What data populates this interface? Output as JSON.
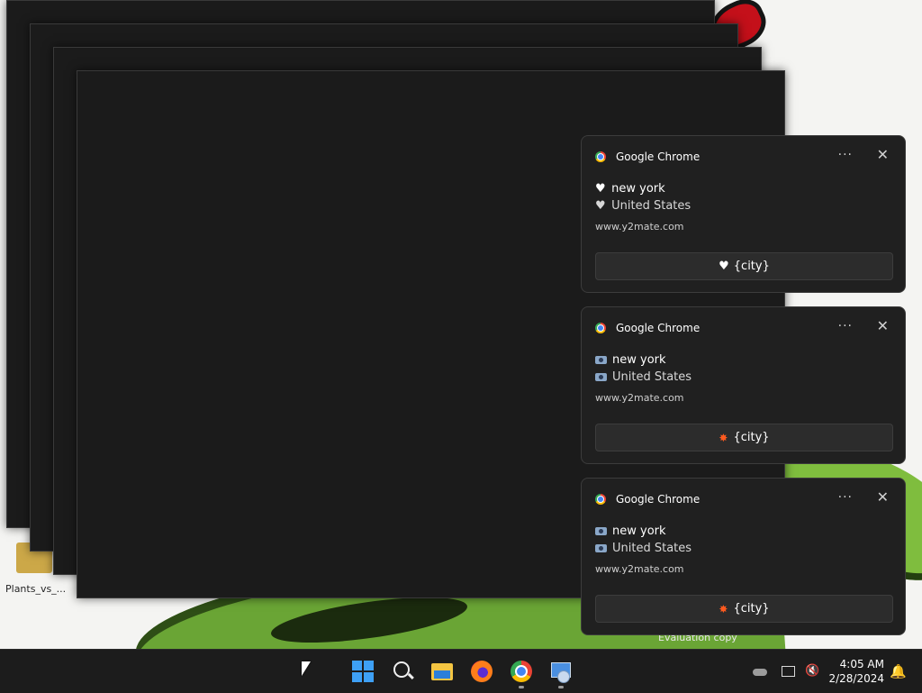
{
  "desktop": {
    "icon_label": "Plants_vs_...",
    "watermark": "Evaluation copy"
  },
  "notifications": [
    {
      "app_name": "Google Chrome",
      "more_label": "···",
      "close_label": "✕",
      "line1": "new york",
      "line2": "United States",
      "line_icon": "heart",
      "site": "www.y2mate.com",
      "action_label": "{city}",
      "action_icon": "heart"
    },
    {
      "app_name": "Google Chrome",
      "more_label": "···",
      "close_label": "✕",
      "line1": "new york",
      "line2": "United States",
      "line_icon": "camera",
      "site": "www.y2mate.com",
      "action_label": "{city}",
      "action_icon": "burst"
    },
    {
      "app_name": "Google Chrome",
      "more_label": "···",
      "close_label": "✕",
      "line1": "new york",
      "line2": "United States",
      "line_icon": "camera",
      "site": "www.y2mate.com",
      "action_label": "{city}",
      "action_icon": "burst"
    }
  ],
  "taskbar": {
    "pinned": [
      "start-icon",
      "search-icon",
      "file-explorer-icon",
      "firefox-icon",
      "chrome-icon",
      "app-icon"
    ],
    "time": "4:05 AM",
    "date": "2/28/2024"
  },
  "colors": {
    "accent": "#3ea0f5",
    "toast_bg": "#202020",
    "taskbar_bg": "#1c1c1c"
  }
}
